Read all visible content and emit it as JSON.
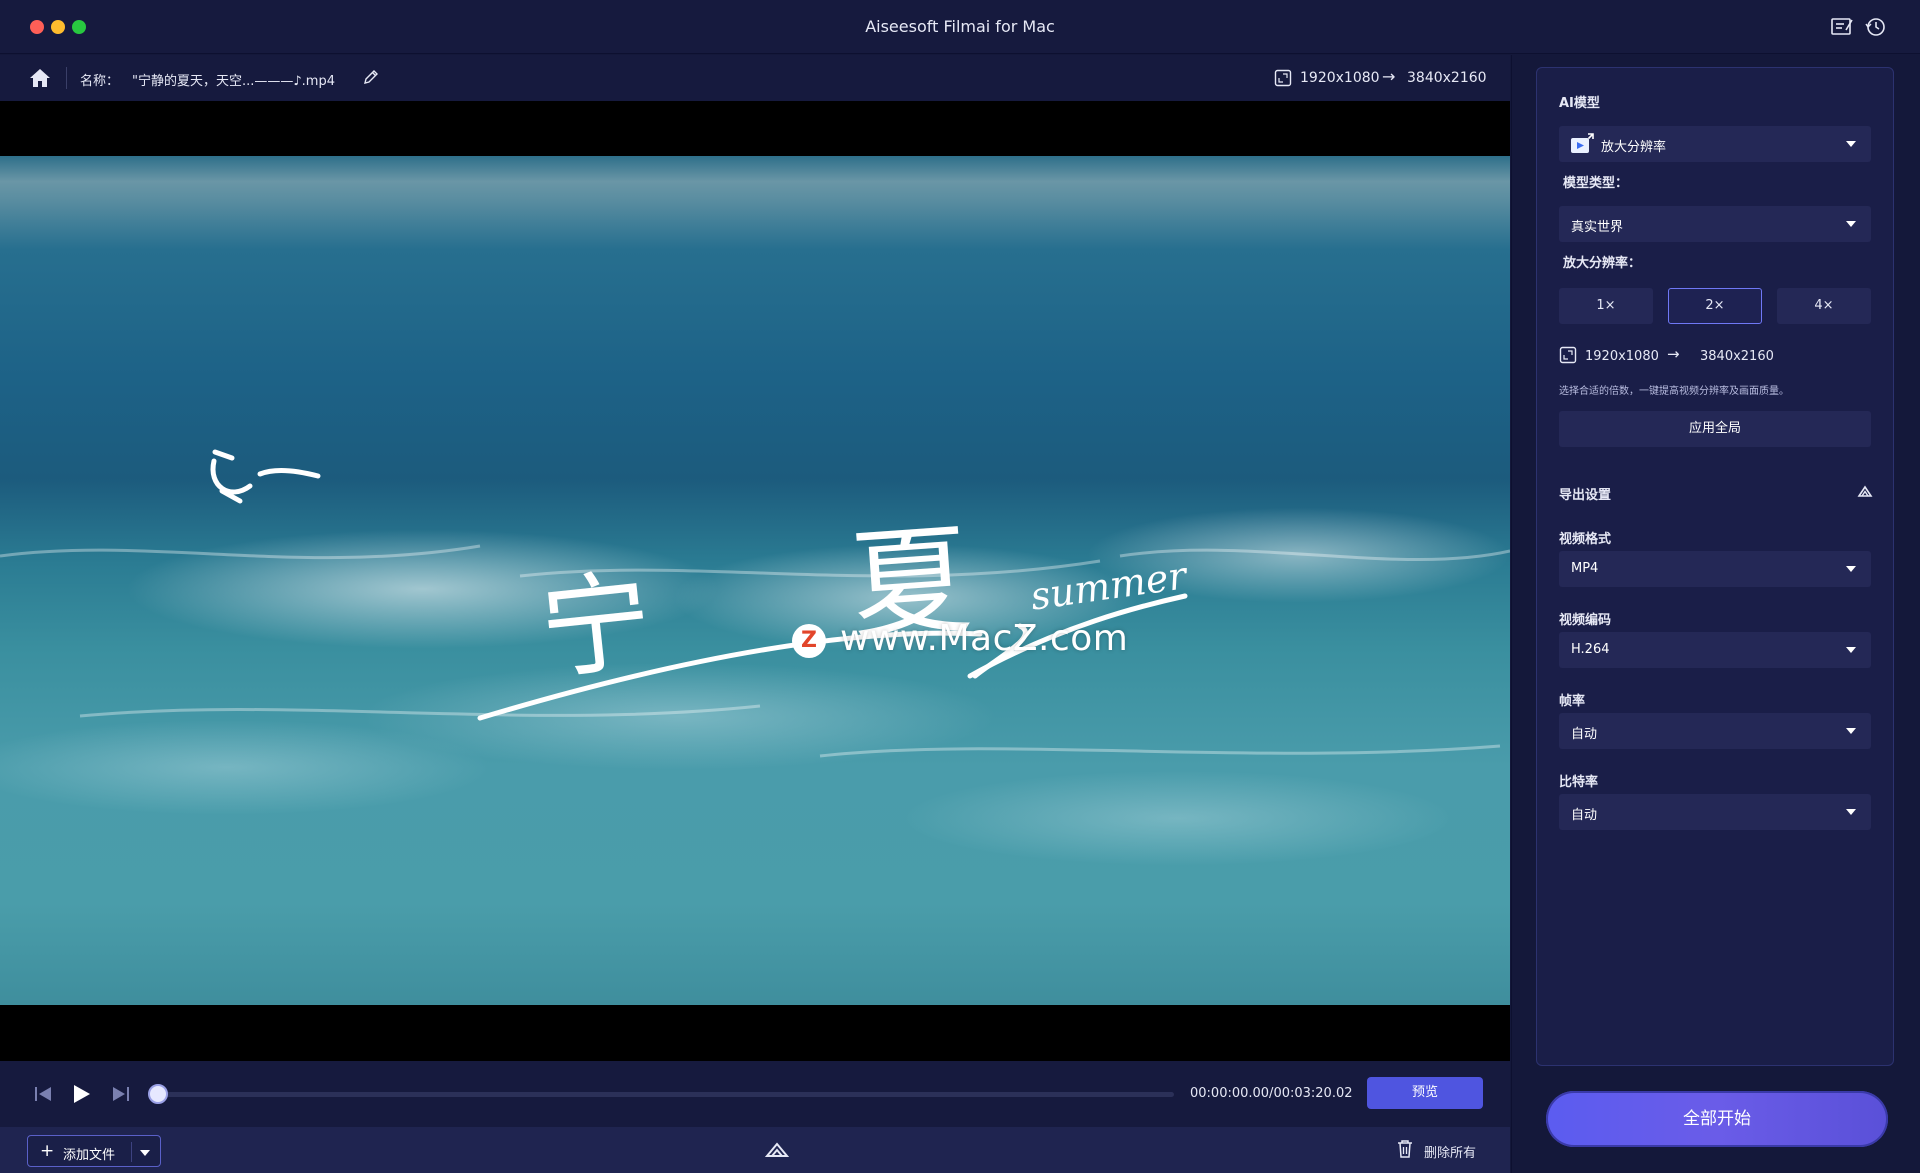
{
  "window": {
    "title": "Aiseesoft Filmai for Mac"
  },
  "infobar": {
    "name_label": "名称：",
    "file_name": "\"宁静的夏天，天空...———♪.mp4",
    "res_from": "1920x1080",
    "res_to": "3840x2160"
  },
  "video": {
    "watermark_text": "www.MacZ.com",
    "watermark_logo": "Z",
    "overlay_chars": [
      "宁",
      "夏"
    ],
    "overlay_script": "summer"
  },
  "player": {
    "time": "00:00:00.00/00:03:20.02",
    "progress": 0.0,
    "preview_label": "预览"
  },
  "bottombar": {
    "add_file_label": "添加文件",
    "delete_all_label": "删除所有"
  },
  "settings": {
    "ai_model_label": "AI模型",
    "ai_model_value": "放大分辨率",
    "model_type_label": "模型类型：",
    "model_type_value": "真实世界",
    "upscale_label": "放大分辨率：",
    "scale_options": [
      "1×",
      "2×",
      "4×"
    ],
    "scale_selected": "2×",
    "res_from": "1920x1080",
    "res_to": "3840x2160",
    "hint": "选择合适的倍数，一键提高视频分辨率及画面质量。",
    "apply_all_label": "应用全局",
    "export_label": "导出设置",
    "format_label": "视频格式",
    "format_value": "MP4",
    "codec_label": "视频编码",
    "codec_value": "H.264",
    "fps_label": "帧率",
    "fps_value": "自动",
    "bitrate_label": "比特率",
    "bitrate_value": "自动"
  },
  "start_all_label": "全部开始",
  "colors": {
    "accent": "#5b5cf0",
    "panel": "#1a1e48",
    "background": "#14183a"
  }
}
